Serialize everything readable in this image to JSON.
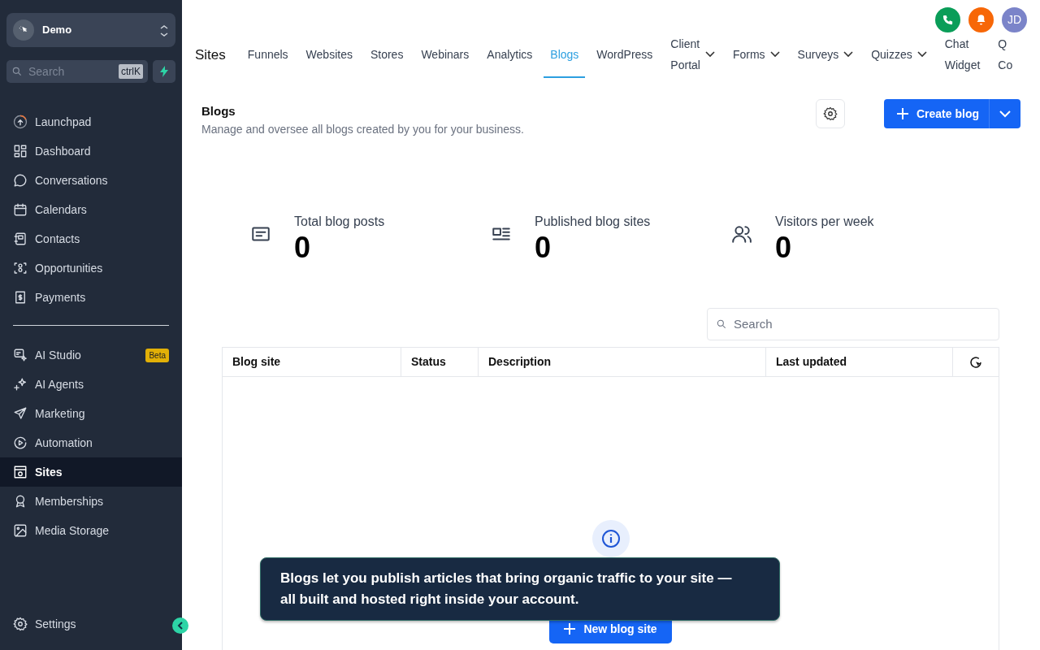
{
  "account": {
    "name": "Demo"
  },
  "sidebar_search": {
    "placeholder": "Search",
    "shortcut": "ctrlK"
  },
  "sidebar": {
    "groups": [
      {
        "items": [
          {
            "label": "Launchpad",
            "selected": false
          },
          {
            "label": "Dashboard",
            "selected": false
          },
          {
            "label": "Conversations",
            "selected": false
          },
          {
            "label": "Calendars",
            "selected": false
          },
          {
            "label": "Contacts",
            "selected": false
          },
          {
            "label": "Opportunities",
            "selected": false
          },
          {
            "label": "Payments",
            "selected": false
          }
        ]
      },
      {
        "items": [
          {
            "label": "AI Studio",
            "badge": "Beta",
            "selected": false
          },
          {
            "label": "AI Agents",
            "selected": false
          },
          {
            "label": "Marketing",
            "selected": false
          },
          {
            "label": "Automation",
            "selected": false
          },
          {
            "label": "Sites",
            "selected": true
          },
          {
            "label": "Memberships",
            "selected": false
          },
          {
            "label": "Media Storage",
            "selected": false
          }
        ]
      }
    ],
    "settings": "Settings"
  },
  "header": {
    "avatar": "JD"
  },
  "section_title": "Sites",
  "tabs": [
    {
      "lines": [
        "Funnels"
      ],
      "selected": false
    },
    {
      "lines": [
        "Websites"
      ],
      "selected": false
    },
    {
      "lines": [
        "Stores"
      ],
      "selected": false
    },
    {
      "lines": [
        "Webinars"
      ],
      "selected": false
    },
    {
      "lines": [
        "Analytics"
      ],
      "selected": false
    },
    {
      "lines": [
        "Blogs"
      ],
      "selected": true
    },
    {
      "lines": [
        "WordPress"
      ],
      "selected": false
    },
    {
      "lines": [
        "Client",
        "Portal"
      ],
      "selected": false,
      "dropdown": true
    },
    {
      "lines": [
        "Forms"
      ],
      "selected": false,
      "dropdown": true
    },
    {
      "lines": [
        "Surveys"
      ],
      "selected": false,
      "dropdown": true
    },
    {
      "lines": [
        "Quizzes"
      ],
      "selected": false,
      "dropdown": true
    },
    {
      "lines": [
        "Chat",
        "Widget"
      ],
      "selected": false
    },
    {
      "lines": [
        "Q",
        "Co"
      ],
      "selected": false
    }
  ],
  "page": {
    "title": "Blogs",
    "subtitle": "Manage and oversee all blogs created by you for your business.",
    "create_button": "Create blog"
  },
  "stats": [
    {
      "label": "Total blog posts",
      "value": "0"
    },
    {
      "label": "Published blog sites",
      "value": "0"
    },
    {
      "label": "Visitors per week",
      "value": "0"
    }
  ],
  "table": {
    "search_placeholder": "Search",
    "columns": [
      "Blog site",
      "Status",
      "Description",
      "Last updated"
    ]
  },
  "empty_state": {
    "button": "New blog site"
  },
  "tooltip": {
    "text": "Blogs let you publish articles that bring organic traffic to your site — all built and hosted right inside your account."
  }
}
